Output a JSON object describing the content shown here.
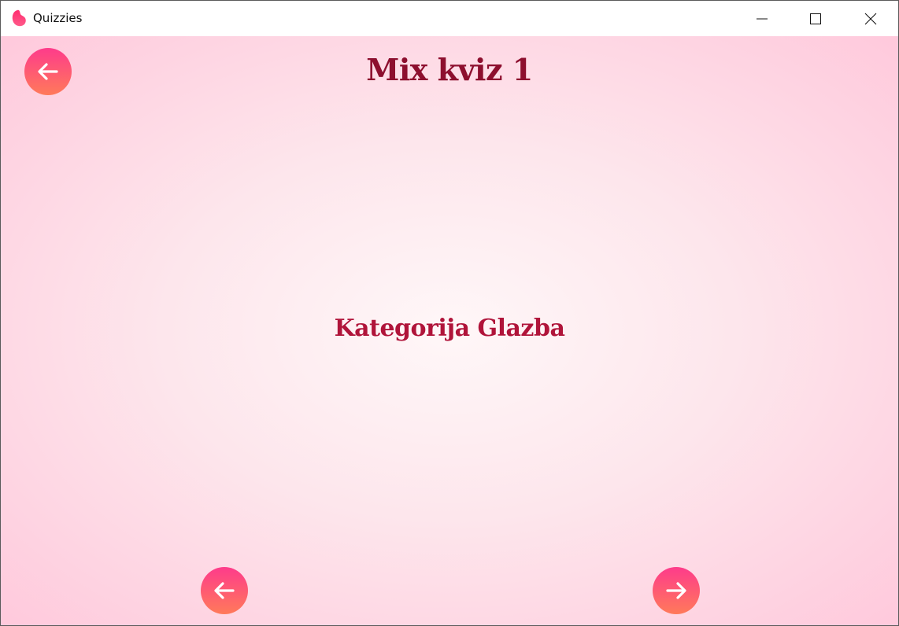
{
  "window": {
    "title": "Quizzies",
    "logo_icon": "quizzies-logo-icon",
    "controls": [
      "minimize-icon",
      "maximize-icon",
      "close-icon"
    ]
  },
  "quiz": {
    "title": "Mix kviz 1",
    "category": "Kategorija Glazba"
  },
  "buttons": {
    "back_icon": "arrow-left-icon",
    "prev_icon": "arrow-left-icon",
    "next_icon": "arrow-right-icon"
  },
  "colors": {
    "title": "#8d0f2e",
    "category": "#b0143a",
    "button_gradient_top": "#fe3b8b",
    "button_gradient_bottom": "#ff7a5a",
    "background_center": "#fff7f8",
    "background_edge": "#ffc9dc"
  }
}
